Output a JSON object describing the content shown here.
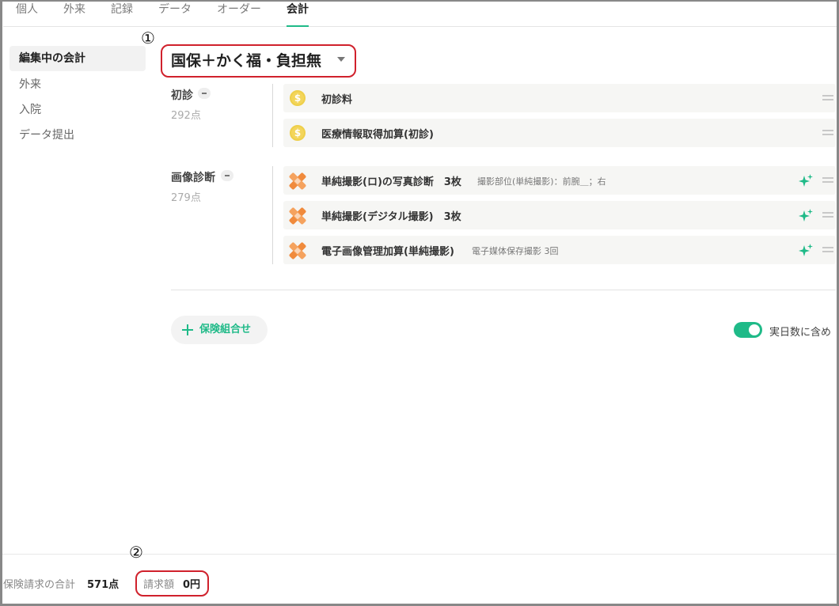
{
  "tabs": [
    "個人",
    "外来",
    "記録",
    "データ",
    "オーダー",
    "会計"
  ],
  "active_tab": "会計",
  "side_nav": [
    "編集中の会計",
    "外来",
    "入院",
    "データ提出"
  ],
  "annotations": {
    "one": "①",
    "two": "②"
  },
  "insurance_selector": {
    "label": "国保＋かく福・負担無"
  },
  "groups": [
    {
      "name": "初診",
      "points": "292点",
      "items": [
        {
          "name": "初診料",
          "detail": "",
          "icon": "coin-icon"
        },
        {
          "name": "医療情報取得加算(初診)",
          "detail": "",
          "icon": "coin-icon"
        }
      ]
    },
    {
      "name": "画像診断",
      "points": "279点",
      "items": [
        {
          "name": "単純撮影(ロ)の写真診断　3枚",
          "detail": "撮影部位(単純撮影)：前腕＿；右",
          "icon": "xray-icon"
        },
        {
          "name": "単純撮影(デジタル撮影)　3枚",
          "detail": "",
          "icon": "xray-icon"
        },
        {
          "name": "電子画像管理加算(単純撮影)",
          "detail": "電子媒体保存撮影 3回",
          "icon": "xray-icon"
        }
      ]
    }
  ],
  "add_combination_label": "保険組合せ",
  "toggle": {
    "label": "実日数に含め",
    "on": true
  },
  "footer": {
    "claim_total_label": "保険請求の合計",
    "claim_total_value": "571点",
    "billing_label": "請求額",
    "billing_value": "0円"
  },
  "colors": {
    "accent": "#1fba88",
    "annotation_red": "#d0212c",
    "coin": "#f3d55b",
    "xray": "#f08a3c"
  }
}
